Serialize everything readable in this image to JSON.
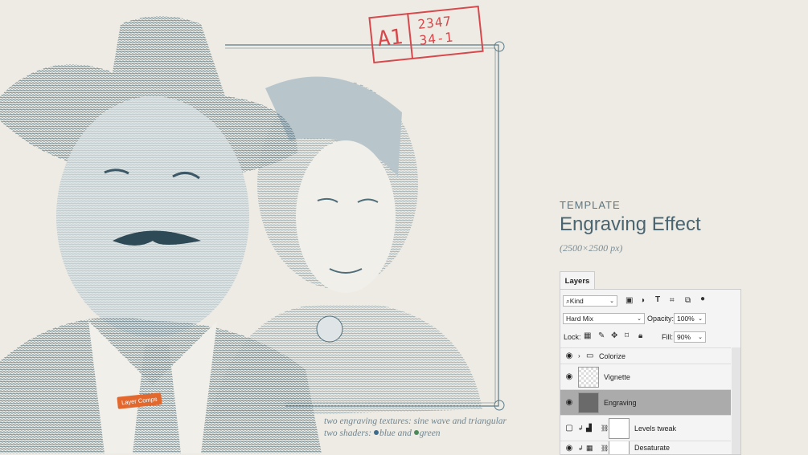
{
  "stamp": {
    "left": "A1",
    "line1": "2347",
    "line2": "34-1"
  },
  "caption": {
    "line1": "two engraving textures: sine wave and triangular",
    "line2_pre": "two shaders: ",
    "blue": "blue",
    "and": " and ",
    "green": "green"
  },
  "colors": {
    "ink": "#4a6470",
    "stamp": "#d7484c",
    "accent": "#e2682e",
    "blue_dot": "#3d6b8a",
    "green_dot": "#4a8a5a"
  },
  "template": {
    "label": "TEMPLATE",
    "title": "Engraving Effect",
    "size": "(2500×2500 px)"
  },
  "layers": {
    "tab": "Layers",
    "filter": "Kind",
    "blend": "Hard Mix",
    "opacity_label": "Opacity:",
    "opacity": "100%",
    "lock_label": "Lock:",
    "fill_label": "Fill:",
    "fill": "90%",
    "items": [
      {
        "name": "Colorize",
        "visible": true,
        "type": "group"
      },
      {
        "name": "Vignette",
        "visible": true,
        "type": "smart"
      },
      {
        "name": "Engraving",
        "visible": true,
        "type": "smart",
        "selected": true
      },
      {
        "name": "Levels tweak",
        "visible": false,
        "type": "adjustment"
      },
      {
        "name": "Desaturate",
        "visible": true,
        "type": "adjustment"
      }
    ],
    "badge": "Layer Comps"
  }
}
